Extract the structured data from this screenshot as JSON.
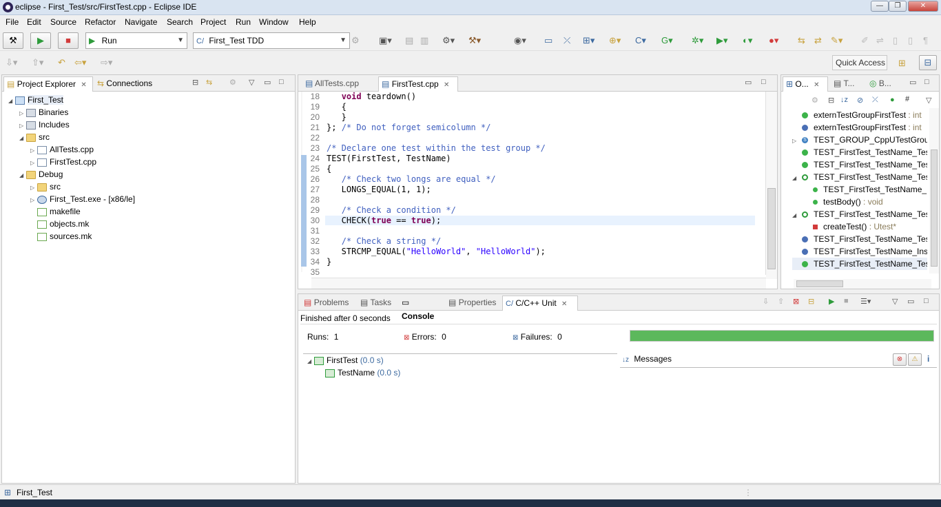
{
  "window": {
    "title": "eclipse - First_Test/src/FirstTest.cpp - Eclipse IDE",
    "minimize": "—",
    "maximize": "❐",
    "close": "✕"
  },
  "menu": [
    "File",
    "Edit",
    "Source",
    "Refactor",
    "Navigate",
    "Search",
    "Project",
    "Run",
    "Window",
    "Help"
  ],
  "toolbar": {
    "launch_mode": "Run",
    "launch_config": "First_Test TDD",
    "quick_access": "Quick Access"
  },
  "project_explorer": {
    "tab_label": "Project Explorer",
    "connections_label": "Connections",
    "tree": [
      {
        "label": "First_Test",
        "icon": "project-icon"
      },
      {
        "label": "Binaries",
        "icon": "binaries-icon"
      },
      {
        "label": "Includes",
        "icon": "includes-icon"
      },
      {
        "label": "src",
        "icon": "folder-icon"
      },
      {
        "label": "AllTests.cpp",
        "icon": "cpp-file-icon"
      },
      {
        "label": "FirstTest.cpp",
        "icon": "cpp-file-icon"
      },
      {
        "label": "Debug",
        "icon": "folder-icon"
      },
      {
        "label": "src",
        "icon": "folder-icon"
      },
      {
        "label": "First_Test.exe - [x86/le]",
        "icon": "executable-icon"
      },
      {
        "label": "makefile",
        "icon": "makefile-icon"
      },
      {
        "label": "objects.mk",
        "icon": "makefile-icon"
      },
      {
        "label": "sources.mk",
        "icon": "makefile-icon"
      }
    ]
  },
  "editor": {
    "tabs": [
      "AllTests.cpp",
      "FirstTest.cpp"
    ],
    "line_numbers": [
      "18",
      "19",
      "20",
      "21",
      "22",
      "23",
      "24",
      "25",
      "26",
      "27",
      "28",
      "29",
      "30",
      "31",
      "32",
      "33",
      "34",
      "35"
    ]
  },
  "outline": {
    "tabs": [
      "O...",
      "T...",
      "B..."
    ],
    "items": [
      {
        "name": "externTestGroupFirstTest",
        "type": " : int"
      },
      {
        "name": "externTestGroupFirstTest",
        "type": " : int"
      },
      {
        "name": "TEST_GROUP_CppUTestGroup",
        "type": ""
      },
      {
        "name": "TEST_FirstTest_TestName_Tes",
        "type": ""
      },
      {
        "name": "TEST_FirstTest_TestName_Tes",
        "type": ""
      },
      {
        "name": "TEST_FirstTest_TestName_Tes",
        "type": ""
      },
      {
        "name": "TEST_FirstTest_TestName_",
        "type": ""
      },
      {
        "name": "testBody()",
        "type": " : void"
      },
      {
        "name": "TEST_FirstTest_TestName_Tes",
        "type": ""
      },
      {
        "name": "createTest()",
        "type": " : Utest*"
      },
      {
        "name": "TEST_FirstTest_TestName_Tes",
        "type": ""
      },
      {
        "name": "TEST_FirstTest_TestName_Inst",
        "type": ""
      },
      {
        "name": "TEST_FirstTest_TestName_Tes",
        "type": ""
      }
    ]
  },
  "bottom": {
    "tabs": [
      "Problems",
      "Tasks",
      "Console",
      "Properties",
      "C/C++ Unit"
    ],
    "finished": "Finished after 0 seconds",
    "runs_label": "Runs:",
    "runs_value": "1",
    "errors_label": "Errors:",
    "errors_value": "0",
    "failures_label": "Failures:",
    "failures_value": "0",
    "progress": 1.0,
    "progress_color": "#5cb85c",
    "tests": [
      {
        "name": "FirstTest",
        "time": "(0.0 s)"
      },
      {
        "name": "TestName",
        "time": "(0.0 s)"
      }
    ],
    "messages_label": "Messages"
  },
  "status": {
    "selected": "First_Test"
  }
}
